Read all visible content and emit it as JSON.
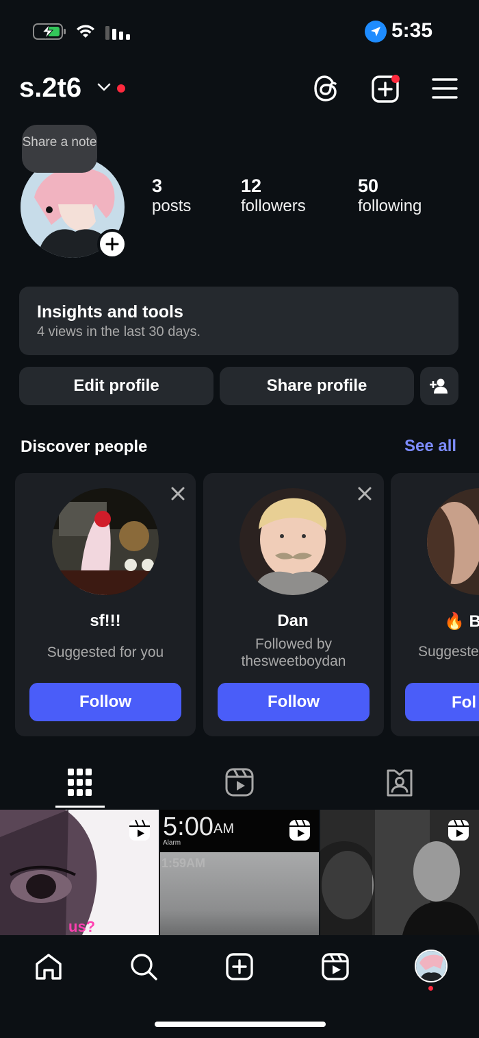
{
  "status_bar": {
    "time": "5:35"
  },
  "header": {
    "username": "s.2t6"
  },
  "profile": {
    "note_prompt": "Share a note",
    "stats": [
      {
        "value": "3",
        "label": "posts"
      },
      {
        "value": "12",
        "label": "followers"
      },
      {
        "value": "50",
        "label": "following"
      }
    ]
  },
  "insights": {
    "title": "Insights and tools",
    "subtitle": "4 views in the last 30 days."
  },
  "actions": {
    "edit_label": "Edit profile",
    "share_label": "Share profile"
  },
  "discover": {
    "title": "Discover people",
    "see_all": "See all",
    "cards": [
      {
        "name": "sf!!!",
        "subtitle": "Suggested for you",
        "follow": "Follow"
      },
      {
        "name": "Dan",
        "subtitle_line1": "Followed by",
        "subtitle_line2": "thesweetboydan",
        "follow": "Follow"
      },
      {
        "name_partial": "🔥 B",
        "subtitle_partial": "Suggeste",
        "follow_partial": "Fol"
      }
    ]
  },
  "grid": [
    {
      "overlay_text": "us?"
    },
    {
      "time_text": "5:00",
      "ampm": "AM",
      "alarm": "Alarm",
      "faded_time": "1:59AM"
    },
    {}
  ]
}
